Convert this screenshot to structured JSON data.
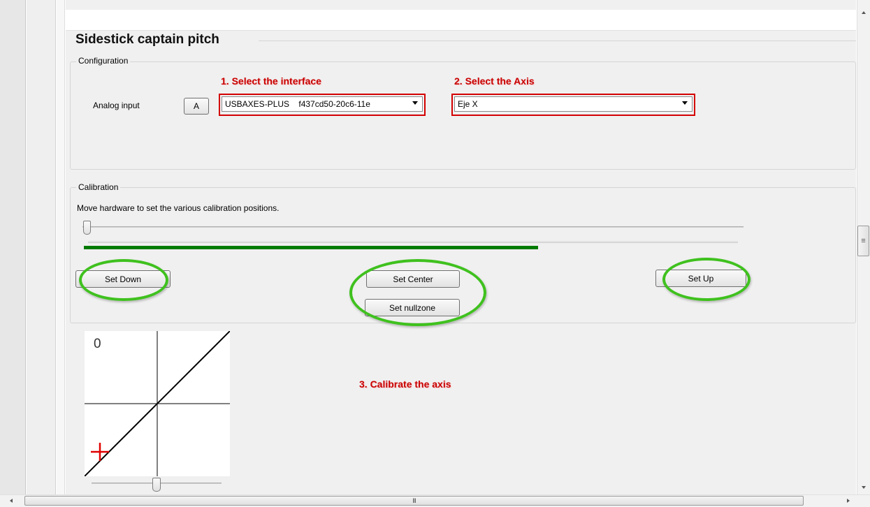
{
  "window": {
    "title": "Sidestick captain pitch"
  },
  "configuration": {
    "legend": "Configuration",
    "analog_input_label": "Analog input",
    "axis_button_label": "A",
    "interface_select": {
      "value": "USBAXES-PLUS    f437cd50-20c6-11e"
    },
    "axis_select": {
      "value": "Eje X"
    }
  },
  "calibration": {
    "legend": "Calibration",
    "instructions": "Move hardware to set the various calibration positions.",
    "slider_value_percent": 2,
    "progress_percent": 68,
    "set_down_label": "Set Down",
    "set_center_label": "Set Center",
    "set_nullzone_label": "Set nullzone",
    "set_up_label": "Set Up"
  },
  "curve_preview": {
    "value_label": "0",
    "slider_value_percent": 52
  },
  "annotations": {
    "step1": "1. Select the interface",
    "step2": "2. Select the Axis",
    "step3": "3. Calibrate the axis"
  },
  "scrollbar": {
    "grip_glyph": "≡",
    "h_grip_glyph": "III"
  },
  "colors": {
    "highlight_red": "#d40000",
    "annotation_red": "#c80000",
    "ellipse_green": "#3fc11e",
    "progress_green": "#007a00"
  },
  "icons": {
    "dropdown": "chevron-down-icon",
    "cursor_marker": "red-cross-icon"
  }
}
